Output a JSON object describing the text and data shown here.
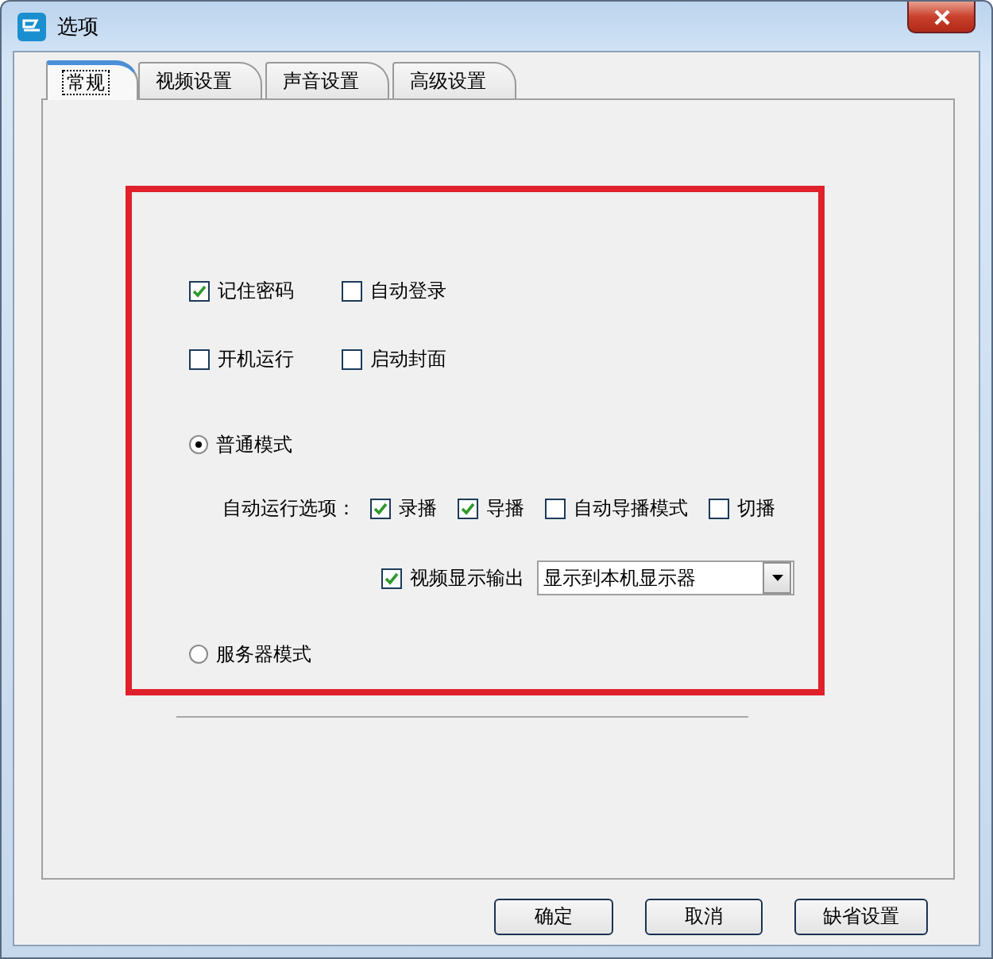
{
  "window": {
    "title": "选项"
  },
  "tabs": [
    {
      "label": "常规",
      "selected": true
    },
    {
      "label": "视频设置",
      "selected": false
    },
    {
      "label": "声音设置",
      "selected": false
    },
    {
      "label": "高级设置",
      "selected": false
    }
  ],
  "login_options": [
    {
      "label": "记住密码",
      "checked": true
    },
    {
      "label": "自动登录",
      "checked": false
    },
    {
      "label": "开机运行",
      "checked": false
    },
    {
      "label": "启动封面",
      "checked": false
    }
  ],
  "modes": [
    {
      "label": "普通模式",
      "selected": true
    },
    {
      "label": "服务器模式",
      "selected": false
    }
  ],
  "auto_run": {
    "label": "自动运行选项：",
    "options": [
      {
        "label": "录播",
        "checked": true
      },
      {
        "label": "导播",
        "checked": true
      },
      {
        "label": "自动导播模式",
        "checked": false
      },
      {
        "label": "切播",
        "checked": false
      }
    ]
  },
  "video_output": {
    "label": "视频显示输出",
    "checked": true,
    "value": "显示到本机显示器"
  },
  "buttons": [
    "确定",
    "取消",
    "缺省设置"
  ]
}
